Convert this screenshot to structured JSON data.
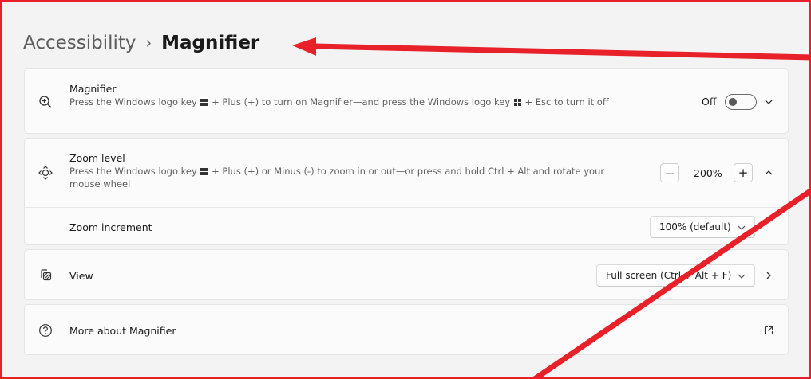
{
  "breadcrumb": {
    "parent": "Accessibility",
    "separator": "›",
    "current": "Magnifier"
  },
  "magnifier": {
    "title": "Magnifier",
    "desc_part1": "Press the Windows logo key",
    "desc_part2": "+ Plus (+) to turn on Magnifier—and press the Windows logo key",
    "desc_part3": "+ Esc to turn it off",
    "toggle_label": "Off",
    "toggle_on": false,
    "icon": "zoom-in-icon"
  },
  "zoom_level": {
    "title": "Zoom level",
    "desc_part1": "Press the Windows logo key",
    "desc_part2": "+ Plus (+) or Minus (-) to zoom in or out—or press and hold Ctrl + Alt and rotate your mouse wheel",
    "value": "200%",
    "minus": "—",
    "plus": "+",
    "icon": "move-arrows-icon"
  },
  "zoom_increment": {
    "label": "Zoom increment",
    "selected": "100% (default)"
  },
  "view": {
    "title": "View",
    "selected": "Full screen (Ctrl + Alt + F)",
    "icon": "view-icon"
  },
  "more_about": {
    "title": "More about Magnifier",
    "icon": "help-circle-icon",
    "link_icon": "open-external-icon"
  },
  "colors": {
    "annotation": "#e8202a",
    "background": "#f3f3f3",
    "card": "#fbfbfb"
  }
}
